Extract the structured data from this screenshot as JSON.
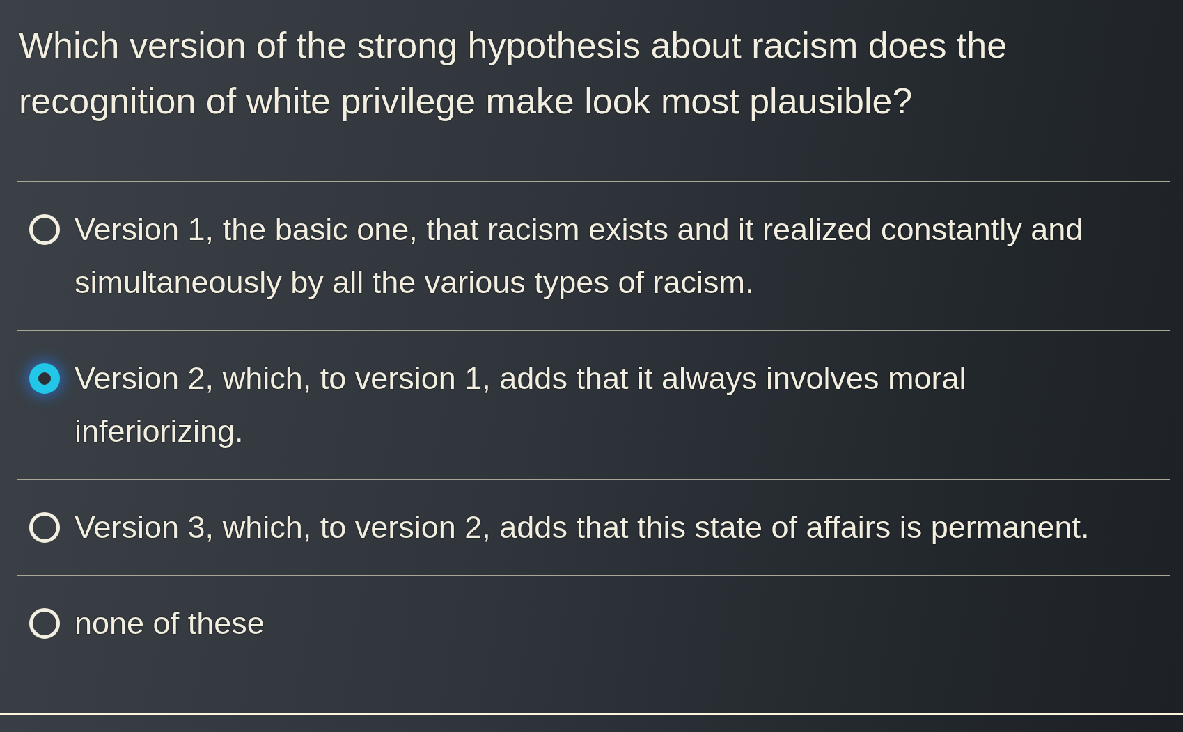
{
  "question": "Which version of the strong hypothesis about racism does the recognition of white privilege make look most plausible?",
  "options": [
    {
      "label": "Version 1, the basic one, that racism exists and it realized constantly and simultaneously by all the various types of racism.",
      "selected": false
    },
    {
      "label": "Version 2, which, to version 1, adds that it always involves moral inferiorizing.",
      "selected": true
    },
    {
      "label": "Version 3, which, to version 2, adds that this state of affairs is permanent.",
      "selected": false
    },
    {
      "label": "none of these",
      "selected": false
    }
  ]
}
